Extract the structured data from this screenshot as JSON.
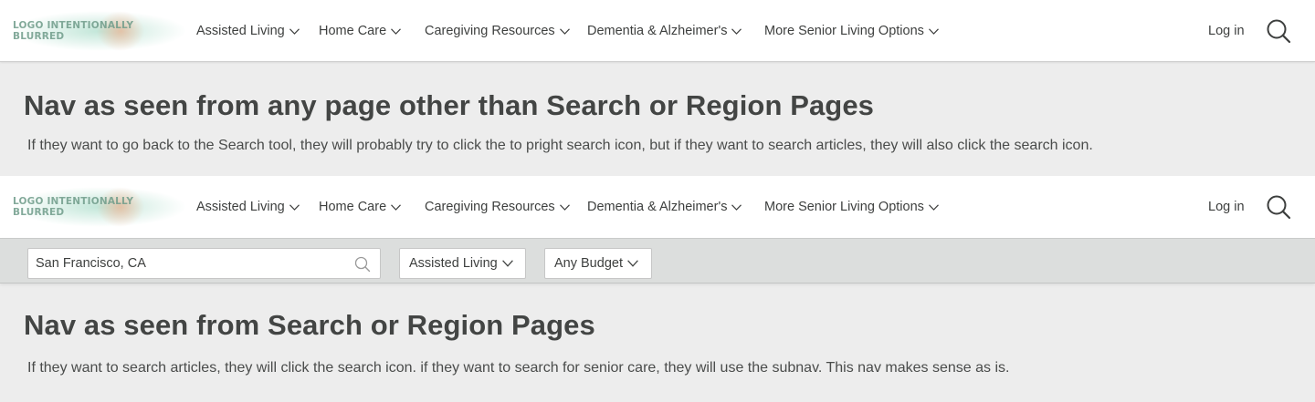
{
  "logo_text": "LOGO INTENTIONALLY BLURRED",
  "nav": {
    "items": [
      {
        "label": "Assisted Living"
      },
      {
        "label": "Home Care"
      },
      {
        "label": "Caregiving Resources"
      },
      {
        "label": "Dementia & Alzheimer's"
      },
      {
        "label": "More Senior Living Options"
      }
    ],
    "login_label": "Log in",
    "search_icon": "search-icon"
  },
  "section1": {
    "heading": "Nav as seen from any page other than Search or Region Pages",
    "description": "If they want to go back to the Search tool, they will probably try to click the to pright search icon, but if they want to search articles, they will also click the search icon."
  },
  "subnav": {
    "location_value": "San Francisco, CA",
    "care_type": "Assisted Living",
    "budget": "Any Budget"
  },
  "section2": {
    "heading": "Nav as seen from Search or Region Pages",
    "description": "If they want to search articles, they will click the search icon. if they want to search for senior care, they will use the subnav. This nav makes sense as is."
  },
  "colors": {
    "page_background": "#ededed",
    "nav_background": "#ffffff",
    "subnav_background": "#dcdedd",
    "text": "#3d3f3e"
  }
}
